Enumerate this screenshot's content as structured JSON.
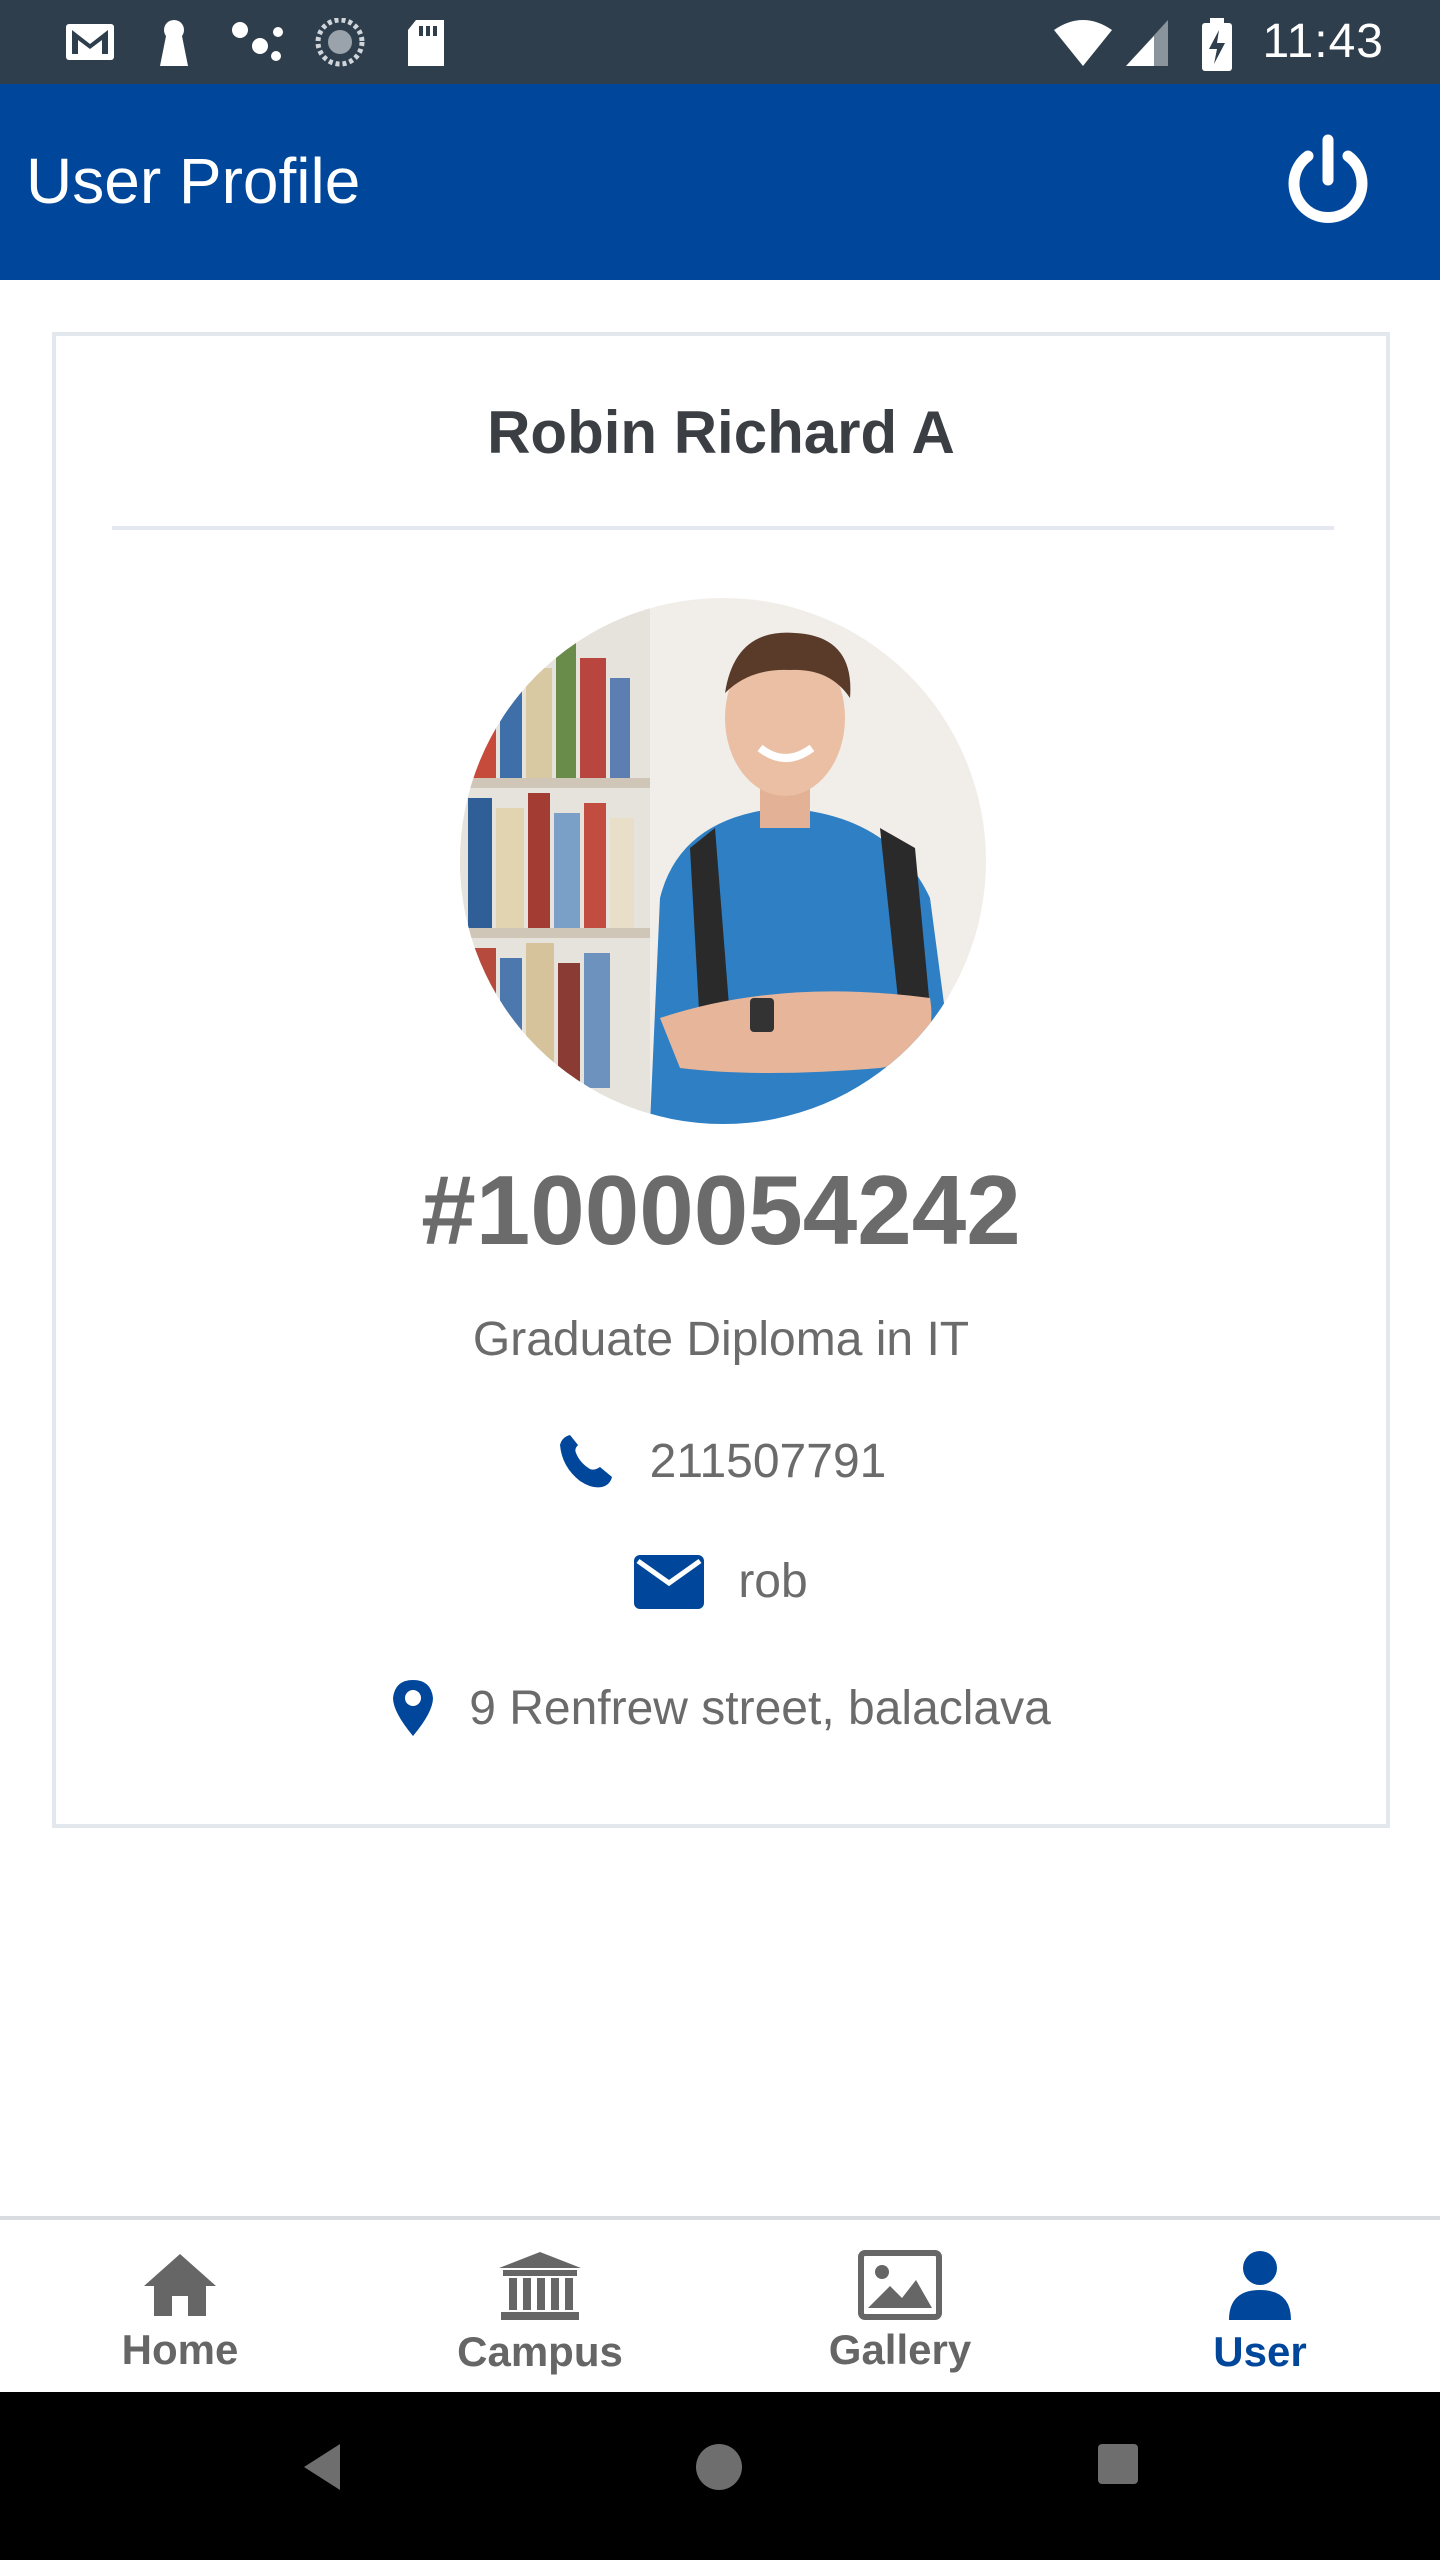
{
  "status_bar": {
    "time": "11:43",
    "left_icons": [
      "gmail-icon",
      "keyhole-icon",
      "dots-icon",
      "sync-icon",
      "sd-card-icon"
    ],
    "right_icons": [
      "wifi-icon",
      "cell-signal-icon",
      "battery-charging-icon"
    ]
  },
  "app_bar": {
    "title": "User Profile",
    "power_icon": "power-icon"
  },
  "profile": {
    "name": "Robin Richard A",
    "student_id": "#1000054242",
    "course": "Graduate Diploma in IT",
    "phone": "211507791",
    "email": "rob",
    "address": "9 Renfrew street, balaclava"
  },
  "bottom_nav": {
    "items": [
      {
        "label": "Home",
        "icon": "home-icon"
      },
      {
        "label": "Campus",
        "icon": "campus-icon"
      },
      {
        "label": "Gallery",
        "icon": "gallery-icon"
      },
      {
        "label": "User",
        "icon": "user-icon"
      }
    ],
    "active": "User"
  },
  "colors": {
    "primary": "#00479b",
    "status_bar": "#2f3e4c",
    "text_muted": "#6b6b6b",
    "text_dark": "#3b3f44"
  },
  "system_nav": [
    "back-icon",
    "home-circle-icon",
    "recents-icon"
  ]
}
